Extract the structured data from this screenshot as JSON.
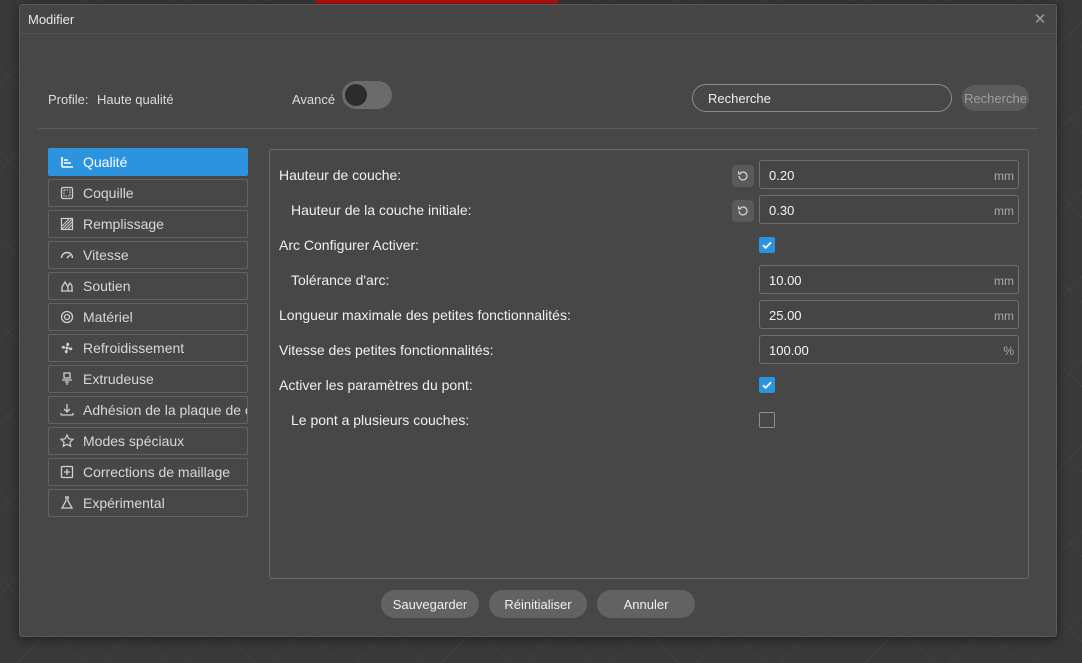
{
  "window": {
    "title": "Modifier"
  },
  "topbar": {
    "profile_label": "Profile:",
    "profile_value": "Haute qualité",
    "advanced_label": "Avancé",
    "advanced_on": false,
    "search_value": "Recherche",
    "search_button": "Recherche"
  },
  "sidebar": {
    "items": [
      {
        "label": "Qualité",
        "icon": "quality-icon",
        "active": true
      },
      {
        "label": "Coquille",
        "icon": "shell-icon"
      },
      {
        "label": "Remplissage",
        "icon": "infill-icon"
      },
      {
        "label": "Vitesse",
        "icon": "speed-icon"
      },
      {
        "label": "Soutien",
        "icon": "support-icon"
      },
      {
        "label": "Matériel",
        "icon": "material-icon"
      },
      {
        "label": "Refroidissement",
        "icon": "fan-icon"
      },
      {
        "label": "Extrudeuse",
        "icon": "extruder-icon"
      },
      {
        "label": "Adhésion de la plaque de construction",
        "icon": "adhesion-icon"
      },
      {
        "label": "Modes spéciaux",
        "icon": "star-icon"
      },
      {
        "label": "Corrections de maillage",
        "icon": "mesh-fix-icon"
      },
      {
        "label": "Expérimental",
        "icon": "flask-icon"
      }
    ]
  },
  "settings": [
    {
      "label": "Hauteur de couche:",
      "type": "number",
      "value": "0.20",
      "unit": "mm",
      "resettable": true
    },
    {
      "label": "Hauteur de la couche initiale:",
      "type": "number",
      "value": "0.30",
      "unit": "mm",
      "resettable": true,
      "indent": true
    },
    {
      "label": "Arc Configurer Activer:",
      "type": "checkbox",
      "checked": true
    },
    {
      "label": "Tolérance d'arc:",
      "type": "number",
      "value": "10.00",
      "unit": "mm",
      "indent": true
    },
    {
      "label": "Longueur maximale des petites fonctionnalités:",
      "type": "number",
      "value": "25.00",
      "unit": "mm"
    },
    {
      "label": "Vitesse des petites fonctionnalités:",
      "type": "number",
      "value": "100.00",
      "unit": "%"
    },
    {
      "label": "Activer les paramètres du pont:",
      "type": "checkbox",
      "checked": true
    },
    {
      "label": "Le pont a plusieurs couches:",
      "type": "checkbox",
      "checked": false,
      "indent": true
    }
  ],
  "footer": {
    "save": "Sauvegarder",
    "reset": "Réinitialiser",
    "cancel": "Annuler"
  },
  "colors": {
    "accent": "#2c93de",
    "dialog_bg": "#474747",
    "field_border": "#6f6f6f"
  }
}
